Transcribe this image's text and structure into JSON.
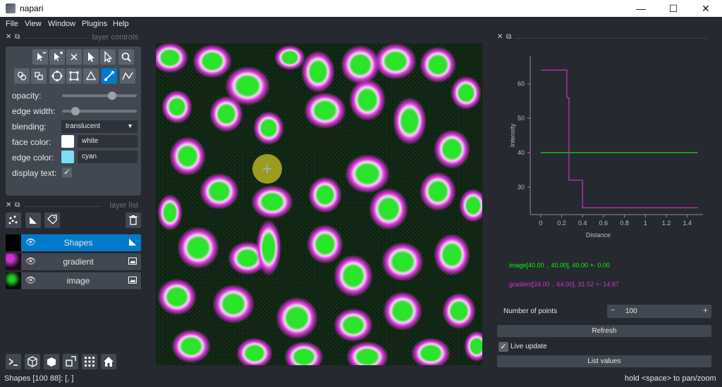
{
  "window": {
    "title": "napari",
    "minimize": "—",
    "maximize": "☐",
    "close": "✕"
  },
  "menu": [
    "File",
    "View",
    "Window",
    "Plugins",
    "Help"
  ],
  "layer_controls": {
    "title": "layer controls",
    "opacity_label": "opacity:",
    "opacity_value": 0.7,
    "edge_width_label": "edge width:",
    "edge_width_value": 0.1,
    "blending_label": "blending:",
    "blending_value": "translucent",
    "face_color_label": "face color:",
    "face_color_value": "white",
    "face_color_hex": "#ffffff",
    "edge_color_label": "edge color:",
    "edge_color_value": "cyan",
    "edge_color_hex": "#7fdcf5",
    "display_text_label": "display text:",
    "display_text_checked": "✓"
  },
  "layer_list": {
    "title": "layer list",
    "layers": [
      {
        "name": "Shapes",
        "selected": true
      },
      {
        "name": "gradient",
        "selected": false
      },
      {
        "name": "image",
        "selected": false
      }
    ]
  },
  "plot": {
    "y_label": "Intensity",
    "x_label": "Distance",
    "y_ticks": [
      "60",
      "50",
      "40",
      "30"
    ],
    "x_ticks": [
      "0",
      "0.2",
      "0.4",
      "0.6",
      "0.8",
      "1",
      "1.2",
      "1.4"
    ],
    "image_stats": "image[40.00 .. 40.00], 40.00 +- 0.00",
    "gradient_stats": "gradient[24.00 .. 64.00], 31.52 +- 14.87",
    "image_color": "#00ff00",
    "gradient_color": "#cc33cc"
  },
  "controls": {
    "num_points_label": "Number of points",
    "num_points_value": "100",
    "minus": "−",
    "plus": "+",
    "refresh_label": "Refresh",
    "live_update_label": "Live update",
    "live_update_checked": "✓",
    "list_values_label": "List values"
  },
  "status": {
    "left": "Shapes [100 88]: [, ]",
    "right": "hold <space> to pan/zoom"
  },
  "chart_data": {
    "type": "line",
    "xlabel": "Distance",
    "ylabel": "Intensity",
    "xlim": [
      -0.1,
      1.55
    ],
    "ylim": [
      22,
      68
    ],
    "series": [
      {
        "name": "image",
        "x": [
          0,
          1.5
        ],
        "y": [
          40,
          40
        ]
      },
      {
        "name": "gradient",
        "x": [
          0,
          0.25,
          0.25,
          0.27,
          0.27,
          0.4,
          0.4,
          1.5
        ],
        "y": [
          64,
          64,
          56,
          56,
          32,
          32,
          24,
          24
        ]
      }
    ]
  }
}
